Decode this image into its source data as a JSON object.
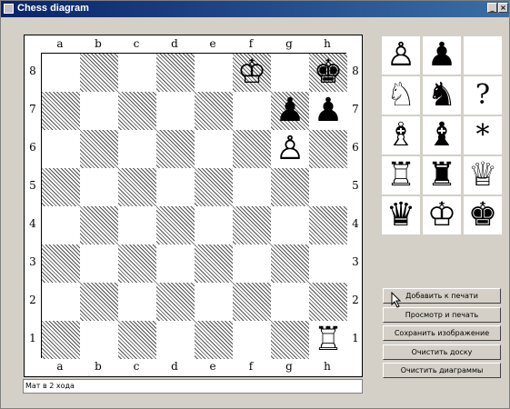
{
  "window": {
    "title": "Chess diagram",
    "minimize_glyph": "_",
    "close_glyph": "×"
  },
  "board": {
    "files": [
      "a",
      "b",
      "c",
      "d",
      "e",
      "f",
      "g",
      "h"
    ],
    "ranks": [
      "8",
      "7",
      "6",
      "5",
      "4",
      "3",
      "2",
      "1"
    ],
    "pieces": [
      {
        "square": "f8",
        "glyph": "♔",
        "name": "white-king"
      },
      {
        "square": "h8",
        "glyph": "♚",
        "name": "black-king"
      },
      {
        "square": "g7",
        "glyph": "♟",
        "name": "black-pawn"
      },
      {
        "square": "h7",
        "glyph": "♟",
        "name": "black-pawn"
      },
      {
        "square": "g6",
        "glyph": "♙",
        "name": "white-pawn"
      },
      {
        "square": "h1",
        "glyph": "♖",
        "name": "white-rook"
      }
    ]
  },
  "palette": [
    {
      "glyph": "♙",
      "name": "white-pawn"
    },
    {
      "glyph": "♟",
      "name": "black-pawn"
    },
    {
      "glyph": "",
      "name": "empty"
    },
    {
      "glyph": "♘",
      "name": "white-knight"
    },
    {
      "glyph": "♞",
      "name": "black-knight"
    },
    {
      "glyph": "?",
      "name": "question-mark"
    },
    {
      "glyph": "♗",
      "name": "white-bishop"
    },
    {
      "glyph": "♝",
      "name": "black-bishop"
    },
    {
      "glyph": "*",
      "name": "asterisk"
    },
    {
      "glyph": "♖",
      "name": "white-rook"
    },
    {
      "glyph": "♜",
      "name": "black-rook"
    },
    {
      "glyph": "♕",
      "name": "white-queen"
    },
    {
      "glyph": "♛",
      "name": "black-queen"
    },
    {
      "glyph": "♔",
      "name": "white-king"
    },
    {
      "glyph": "♚",
      "name": "black-king"
    }
  ],
  "buttons": [
    {
      "label": "Добавить к печати",
      "name": "add-to-print-button"
    },
    {
      "label": "Просмотр и печать",
      "name": "preview-print-button"
    },
    {
      "label": "Сохранить изображение",
      "name": "save-image-button"
    },
    {
      "label": "Очистить доску",
      "name": "clear-board-button"
    },
    {
      "label": "Очистить диаграммы",
      "name": "clear-diagrams-button"
    }
  ],
  "caption": {
    "value": "Мат в 2 хода"
  }
}
